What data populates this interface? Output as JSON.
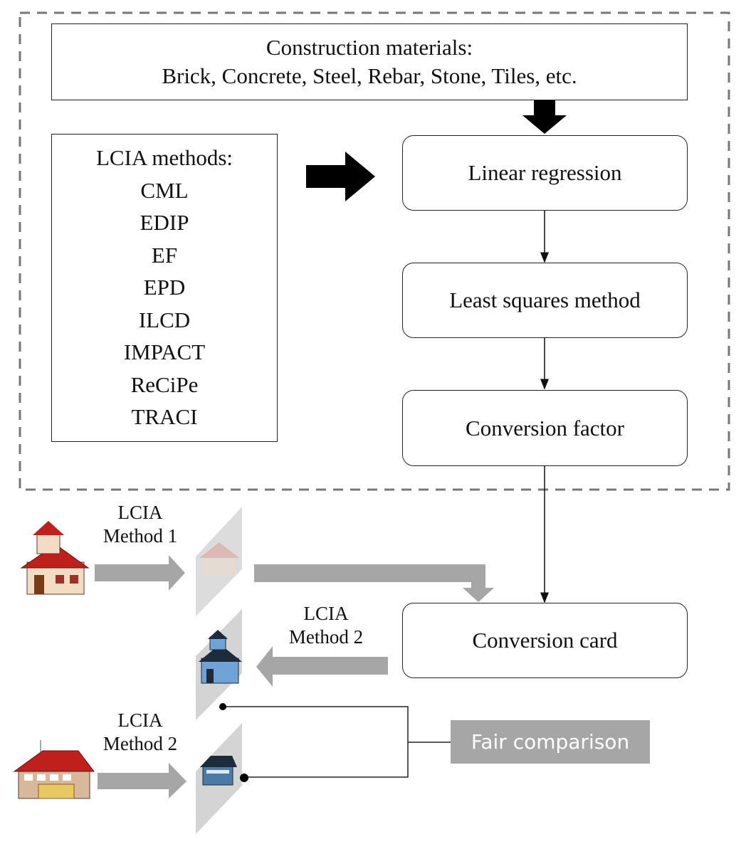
{
  "materials": {
    "title": "Construction materials:",
    "list": "Brick, Concrete, Steel, Rebar, Stone, Tiles, etc."
  },
  "lcia_methods": {
    "title": "LCIA methods:",
    "items": [
      "CML",
      "EDIP",
      "EF",
      "EPD",
      "ILCD",
      "IMPACT",
      "ReCiPe",
      "TRACI"
    ]
  },
  "steps": [
    "Linear regression",
    "Least squares method",
    "Conversion factor",
    "Conversion card"
  ],
  "flows": [
    {
      "line1": "LCIA",
      "line2": "Method  1"
    },
    {
      "line1": "LCIA",
      "line2": "Method  2"
    },
    {
      "line1": "LCIA",
      "line2": "Method  2"
    }
  ],
  "fair_comparison": "Fair comparison",
  "colors": {
    "arrow_gray": "#a6a6a6",
    "panel_gray": "#d9d9d9",
    "roof_red": "#c0201b",
    "blue_house": "#6fa3d6"
  }
}
